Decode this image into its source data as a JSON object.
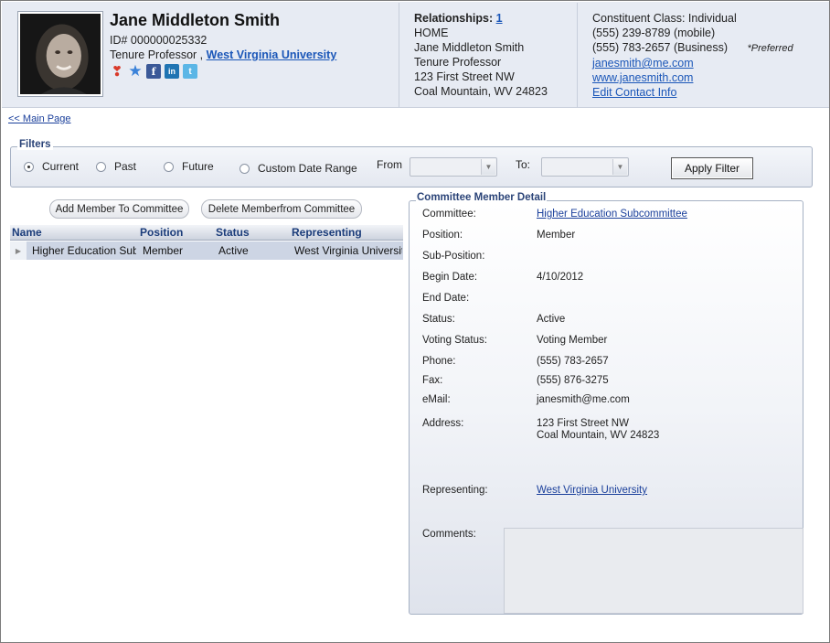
{
  "header": {
    "name": "Jane Middleton Smith",
    "id_line": "ID# 000000025332",
    "title": "Tenure Professor ,",
    "organization": "West Virginia University",
    "social": {
      "heart": "❣",
      "star": "★",
      "facebook": "f",
      "linkedin": "in",
      "twitter": "t"
    }
  },
  "relationships": {
    "label": "Relationships:",
    "count": "1",
    "lines": [
      "HOME",
      "Jane Middleton Smith",
      "Tenure Professor",
      "123 First Street NW",
      "Coal Mountain, WV 24823"
    ]
  },
  "contact": {
    "class_line": "Constituent Class: Individual",
    "mobile": "(555) 239-8789 (mobile)",
    "business": "(555) 783-2657 (Business)",
    "preferred": "*Preferred",
    "email": "janesmith@me.com",
    "website": "www.janesmith.com",
    "edit": "Edit Contact Info"
  },
  "nav": {
    "main_page": "<< Main Page"
  },
  "filters": {
    "legend": "Filters",
    "options": [
      "Current",
      "Past",
      "Future",
      "Custom Date Range"
    ],
    "selected": "Current",
    "from_label": "From",
    "to_label": "To:",
    "from_value": "",
    "to_value": "",
    "apply": "Apply Filter"
  },
  "left": {
    "add_button": "Add Member To Committee",
    "delete_button": "Delete Memberfrom Committee",
    "columns": [
      "Name",
      "Position",
      "Status",
      "Representing"
    ],
    "rows": [
      {
        "name": "Higher Education Subc",
        "position": "Member",
        "status": "Active",
        "representing": "West Virginia University"
      }
    ]
  },
  "detail": {
    "legend": "Committee Member Detail",
    "committee_label": "Committee:",
    "committee_value": "Higher Education Subcommittee",
    "position_label": "Position:",
    "position_value": "Member",
    "subposition_label": "Sub-Position:",
    "subposition_value": "",
    "begin_label": "Begin Date:",
    "begin_value": "4/10/2012",
    "end_label": "End Date:",
    "end_value": "",
    "status_label": "Status:",
    "status_value": "Active",
    "voting_label": "Voting Status:",
    "voting_value": "Voting Member",
    "phone_label": "Phone:",
    "phone_value": "(555) 783-2657",
    "fax_label": "Fax:",
    "fax_value": "(555) 876-3275",
    "email_label": "eMail:",
    "email_value": "janesmith@me.com",
    "address_label": "Address:",
    "address_line1": "123 First Street NW",
    "address_line2": "Coal Mountain, WV 24823",
    "representing_label": "Representing:",
    "representing_value": "West Virginia University",
    "comments_label": "Comments:",
    "comments_value": ""
  }
}
